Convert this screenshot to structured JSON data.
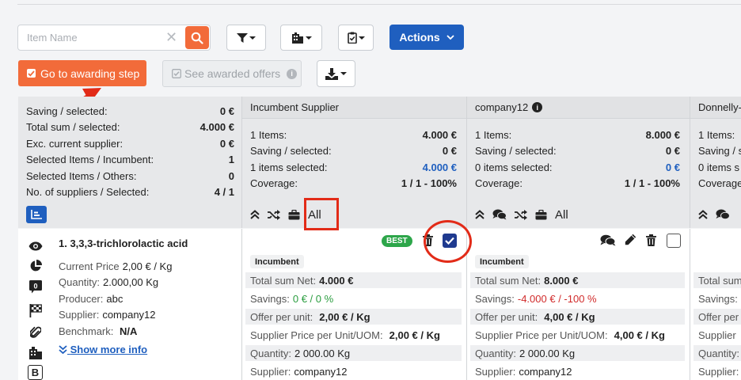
{
  "toolbar": {
    "search_placeholder": "Item Name",
    "actions_label": "Actions",
    "award_label": "Go to awarding step",
    "see_awarded_label": "See awarded offers"
  },
  "summary": {
    "rows": [
      {
        "label": "Saving / selected:",
        "value": "0 €"
      },
      {
        "label": "Total sum / selected:",
        "value": "4.000 €"
      },
      {
        "label": "Exc. current supplier:",
        "value": "0 €"
      },
      {
        "label": "Selected Items / Incumbent:",
        "value": "1"
      },
      {
        "label": "Selected Items / Others:",
        "value": "0"
      },
      {
        "label": "No. of suppliers / Selected:",
        "value": "4 / 1"
      }
    ]
  },
  "suppliers": [
    {
      "name": "Incumbent Supplier",
      "rows": [
        {
          "label": "1 Items:",
          "value": "4.000 €"
        },
        {
          "label": "Saving / selected:",
          "value": "0 €"
        },
        {
          "label": "1 items selected:",
          "value": "4.000 €"
        },
        {
          "label": "Coverage:",
          "value": "1 / 1 - 100%"
        }
      ],
      "all_label": "All"
    },
    {
      "name": "company12",
      "rows": [
        {
          "label": "1 Items:",
          "value": "8.000 €"
        },
        {
          "label": "Saving / selected:",
          "value": "0 €"
        },
        {
          "label": "0 items selected:",
          "value": "0 €"
        },
        {
          "label": "Coverage:",
          "value": "1 / 1 - 100%"
        }
      ],
      "all_label": "All"
    },
    {
      "name": "Donnelly-",
      "rows": [
        {
          "label": "1 Items:",
          "value": ""
        },
        {
          "label": "Saving / s",
          "value": ""
        },
        {
          "label": "0 items s",
          "value": ""
        },
        {
          "label": "Coverage",
          "value": ""
        }
      ]
    }
  ],
  "item": {
    "title": "1. 3,3,3-trichlorolactic acid",
    "current_price_label": "Current Price",
    "current_price": "2,00 € / Kg",
    "quantity_label": "Quantity:",
    "quantity": "2.000,00 Kg",
    "producer_label": "Producer:",
    "producer": "abc",
    "supplier_label": "Supplier:",
    "supplier": "company12",
    "benchmark_label": "Benchmark:",
    "benchmark": "N/A",
    "show_more": "Show more info",
    "comment_count": "0",
    "b_icon": "B"
  },
  "offers": [
    {
      "tag": "Incumbent",
      "best": "BEST",
      "checked": true,
      "total_label": "Total sum Net:",
      "total": "4.000 €",
      "savings_label": "Savings:",
      "savings": "0 € / 0 %",
      "unit_label": "Offer per unit:",
      "unit": "2,00 € / Kg",
      "sp_label": "Supplier Price per Unit/UOM:",
      "sp": "2,00 € / Kg",
      "qty_label": "Quantity:",
      "qty": "2 000.00 Kg",
      "sup_label": "Supplier:",
      "sup": "company12"
    },
    {
      "tag": "Incumbent",
      "checked": false,
      "total_label": "Total sum Net:",
      "total": "8.000 €",
      "savings_label": "Savings:",
      "savings": "-4.000 € / -100 %",
      "unit_label": "Offer per unit:",
      "unit": "4,00 € / Kg",
      "sp_label": "Supplier Price per Unit/UOM:",
      "sp": "4,00 € / Kg",
      "qty_label": "Quantity:",
      "qty": "2 000.00 Kg",
      "sup_label": "Supplier:",
      "sup": "company12"
    },
    {
      "total_label": "Total sum",
      "savings_label": "Savings:",
      "unit_label": "Offer per",
      "sp_label": "Supplier",
      "qty_label": "Quantity:",
      "sup_label": "Supplier:"
    }
  ],
  "colors": {
    "accent_orange": "#f26b3a",
    "primary_blue": "#1f5fbf",
    "annotation_red": "#e22b18"
  }
}
